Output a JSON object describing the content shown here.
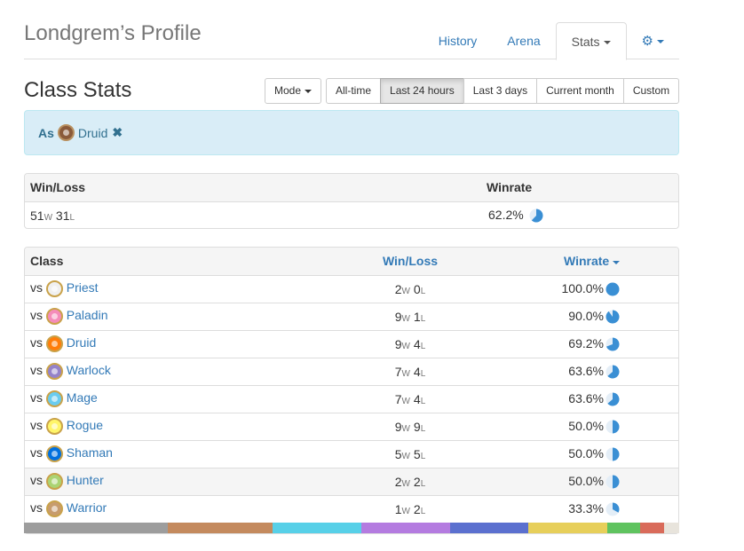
{
  "header": {
    "profile_title": "Londgrem’s Profile",
    "tabs": [
      {
        "label": "History",
        "active": false
      },
      {
        "label": "Arena",
        "active": false
      },
      {
        "label": "Stats",
        "active": true
      }
    ],
    "settings_icon": "gear-icon"
  },
  "class_stats": {
    "title": "Class Stats",
    "mode_label": "Mode",
    "time_filters": [
      {
        "label": "All-time",
        "active": false
      },
      {
        "label": "Last 24 hours",
        "active": true
      },
      {
        "label": "Last 3 days",
        "active": false
      },
      {
        "label": "Current month",
        "active": false
      },
      {
        "label": "Custom",
        "active": false
      }
    ]
  },
  "filter": {
    "as_label": "As",
    "class_name": "Druid",
    "remove_icon": "close-icon"
  },
  "summary": {
    "headers": {
      "winloss": "Win/Loss",
      "winrate": "Winrate"
    },
    "wins": "51",
    "w": "W",
    "losses": "31",
    "l": "L",
    "winrate": "62.2%",
    "winrate_fraction": 0.622
  },
  "classes_table": {
    "headers": {
      "class": "Class",
      "winloss": "Win/Loss",
      "winrate": "Winrate"
    },
    "vs_label": "vs",
    "rows": [
      {
        "name": "Priest",
        "wins": "2",
        "losses": "0",
        "winrate": "100.0%",
        "fraction": 1.0,
        "color": "#f0f0f0"
      },
      {
        "name": "Paladin",
        "wins": "9",
        "losses": "1",
        "winrate": "90.0%",
        "fraction": 0.9,
        "color": "#f58cba"
      },
      {
        "name": "Druid",
        "wins": "9",
        "losses": "4",
        "winrate": "69.2%",
        "fraction": 0.692,
        "color": "#ff7d0a"
      },
      {
        "name": "Warlock",
        "wins": "7",
        "losses": "4",
        "winrate": "63.6%",
        "fraction": 0.636,
        "color": "#9482c9"
      },
      {
        "name": "Mage",
        "wins": "7",
        "losses": "4",
        "winrate": "63.6%",
        "fraction": 0.636,
        "color": "#69ccf0"
      },
      {
        "name": "Rogue",
        "wins": "9",
        "losses": "9",
        "winrate": "50.0%",
        "fraction": 0.5,
        "color": "#fff569"
      },
      {
        "name": "Shaman",
        "wins": "5",
        "losses": "5",
        "winrate": "50.0%",
        "fraction": 0.5,
        "color": "#0070de"
      },
      {
        "name": "Hunter",
        "wins": "2",
        "losses": "2",
        "winrate": "50.0%",
        "fraction": 0.5,
        "color": "#abd473"
      },
      {
        "name": "Warrior",
        "wins": "1",
        "losses": "2",
        "winrate": "33.3%",
        "fraction": 0.333,
        "color": "#c79c6e"
      }
    ]
  },
  "color_strip": [
    {
      "color": "#9d9d9d",
      "share": 0.22
    },
    {
      "color": "#c48a5e",
      "share": 0.16
    },
    {
      "color": "#57d0e8",
      "share": 0.135
    },
    {
      "color": "#b47be0",
      "share": 0.135
    },
    {
      "color": "#5b70cf",
      "share": 0.12
    },
    {
      "color": "#e7cf5a",
      "share": 0.12
    },
    {
      "color": "#5fc35f",
      "share": 0.05
    },
    {
      "color": "#d96b5a",
      "share": 0.037
    },
    {
      "color": "#e8e4dc",
      "share": 0.023
    }
  ],
  "accent_color": "#337ab7",
  "pie_color": "#3a8fd4"
}
